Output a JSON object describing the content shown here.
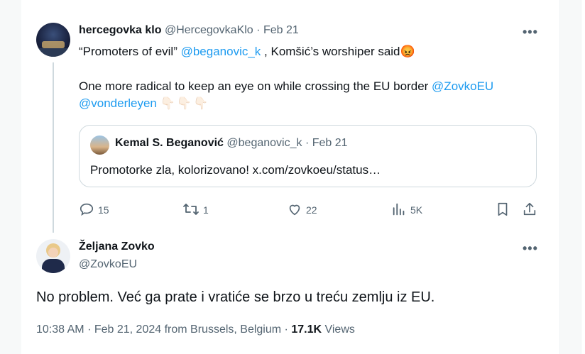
{
  "tweet": {
    "display_name": "hercegovka klo",
    "handle": "@HercegovkaKlo",
    "dot": "·",
    "date": "Feb 21",
    "line1_pre": "“Promoters of evil” ",
    "line1_mention": "@beganovic_k",
    "line1_post": " , Komšić’s worshiper said",
    "line1_emoji": "😡",
    "line2_pre": "One more radical to keep an eye on while crossing the EU border ",
    "line2_mention1": "@ZovkoEU",
    "line2_mention2": "@vonderleyen",
    "line2_emoji": "👇🏻👇🏻👇🏻",
    "more": "•••"
  },
  "quote": {
    "display_name": "Kemal S. Beganović",
    "handle": "@beganovic_k",
    "dot": "·",
    "date": "Feb 21",
    "text": "Promotorke zla, kolorizovano! x.com/zovkoeu/status…"
  },
  "actions": {
    "replies": "15",
    "retweets": "1",
    "likes": "22",
    "views": "5K"
  },
  "reply": {
    "display_name": "Željana Zovko",
    "handle": "@ZovkoEU",
    "more": "•••",
    "text": "No problem. Već ga prate i vratiće se brzo u treću zemlju iz EU.",
    "time": "10:38 AM",
    "dot": "·",
    "date": "Feb 21, 2024",
    "location": "from Brussels, Belgium",
    "dot2": "·",
    "view_count": "17.1K",
    "views_label": "Views"
  },
  "colors": {
    "accent": "#1d9bf0",
    "muted": "#536471",
    "border": "#cfd9de"
  }
}
